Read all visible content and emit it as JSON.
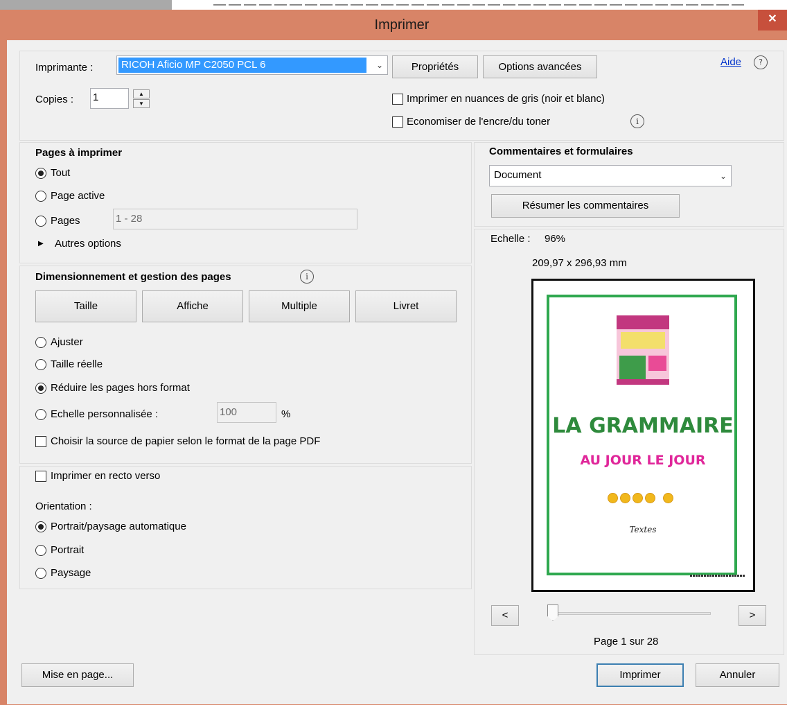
{
  "dialog": {
    "title": "Imprimer",
    "close_glyph": "✕"
  },
  "printer": {
    "label": "Imprimante :",
    "selected": "RICOH Aficio MP C2050 PCL 6",
    "properties_button": "Propriétés",
    "advanced_button": "Options avancées",
    "help_link": "Aide",
    "help_icon_glyph": "?"
  },
  "copies": {
    "label": "Copies :",
    "value": "1",
    "up_glyph": "▲",
    "down_glyph": "▼"
  },
  "options": {
    "grayscale": {
      "label": "Imprimer en nuances de gris (noir et blanc)",
      "checked": false
    },
    "save_ink": {
      "label": "Economiser de l'encre/du toner",
      "checked": false
    }
  },
  "pages": {
    "heading": "Pages à imprimer",
    "all": "Tout",
    "current": "Page active",
    "range": "Pages",
    "range_value": "1 - 28",
    "more_glyph": "▶",
    "more": "Autres options",
    "selected": "all"
  },
  "comments": {
    "heading": "Commentaires et formulaires",
    "selected": "Document",
    "summarize_button": "Résumer les commentaires"
  },
  "sizing": {
    "heading": "Dimensionnement et gestion des pages",
    "tabs": [
      "Taille",
      "Affiche",
      "Multiple",
      "Livret"
    ],
    "fit": "Ajuster",
    "actual": "Taille réelle",
    "shrink": "Réduire les pages hors format",
    "custom": "Echelle personnalisée :",
    "custom_value": "100",
    "custom_unit": "%",
    "paper_source": "Choisir la source de papier selon le format de la page PDF",
    "selected": "shrink"
  },
  "duplex": {
    "label": "Imprimer en recto verso",
    "checked": false
  },
  "orientation": {
    "heading": "Orientation :",
    "auto": "Portrait/paysage automatique",
    "portrait": "Portrait",
    "landscape": "Paysage",
    "selected": "auto"
  },
  "preview": {
    "scale_label": "Echelle :",
    "scale_value": "96%",
    "dimensions": "209,97 x 296,93 mm",
    "page_status": "Page 1 sur 28",
    "prev_glyph": "<",
    "next_glyph": ">",
    "slider_position": 0,
    "document": {
      "title": "LA GRAMMAIRE",
      "subtitle": "AU JOUR LE JOUR",
      "footer": "Textes",
      "dots": 5,
      "accent_green": "#2fa84f",
      "accent_pink": "#e0279a",
      "accent_yellow": "#f1b81c"
    }
  },
  "footer": {
    "page_setup_button": "Mise en page...",
    "print_button": "Imprimer",
    "cancel_button": "Annuler"
  },
  "colors": {
    "title_bar": "#d88467",
    "close_button": "#c7503c",
    "printer_select_highlight": "#3399ff",
    "help_link": "#0033cc"
  }
}
